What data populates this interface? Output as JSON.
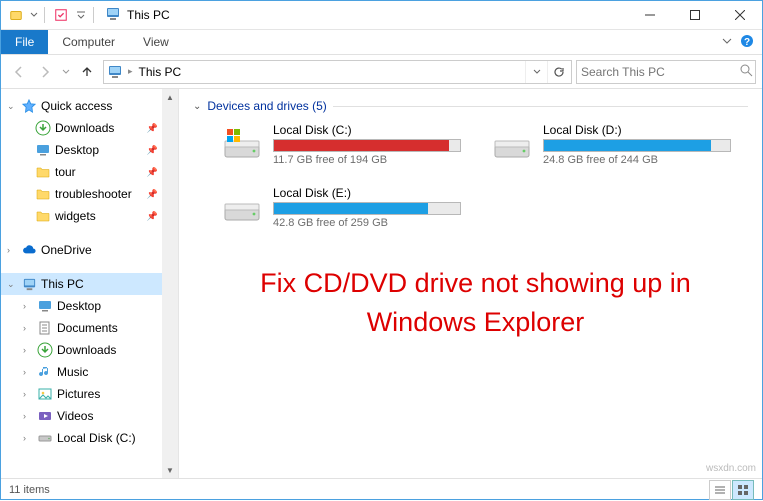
{
  "window": {
    "title": "This PC"
  },
  "ribbon": {
    "file": "File",
    "tabs": [
      "Computer",
      "View"
    ]
  },
  "nav": {
    "location": "This PC",
    "search_placeholder": "Search This PC"
  },
  "sidebar": {
    "quick_access": {
      "label": "Quick access"
    },
    "quick_items": [
      {
        "label": "Downloads",
        "icon": "downloads"
      },
      {
        "label": "Desktop",
        "icon": "desktop"
      },
      {
        "label": "tour",
        "icon": "folder"
      },
      {
        "label": "troubleshooter",
        "icon": "folder"
      },
      {
        "label": "widgets",
        "icon": "folder"
      }
    ],
    "onedrive": {
      "label": "OneDrive"
    },
    "this_pc": {
      "label": "This PC"
    },
    "pc_items": [
      {
        "label": "Desktop",
        "icon": "desktop"
      },
      {
        "label": "Documents",
        "icon": "documents"
      },
      {
        "label": "Downloads",
        "icon": "downloads"
      },
      {
        "label": "Music",
        "icon": "music"
      },
      {
        "label": "Pictures",
        "icon": "pictures"
      },
      {
        "label": "Videos",
        "icon": "videos"
      },
      {
        "label": "Local Disk (C:)",
        "icon": "drive"
      }
    ]
  },
  "content": {
    "group_title": "Devices and drives (5)",
    "drives": [
      {
        "name": "Local Disk (C:)",
        "free": "11.7 GB free of 194 GB",
        "fill_pct": 94,
        "color": "#d62e2e"
      },
      {
        "name": "Local Disk (D:)",
        "free": "24.8 GB free of 244 GB",
        "fill_pct": 90,
        "color": "#1d9fe4"
      },
      {
        "name": "Local Disk (E:)",
        "free": "42.8 GB free of 259 GB",
        "fill_pct": 83,
        "color": "#1d9fe4"
      }
    ],
    "overlay": "Fix CD/DVD drive not showing up in Windows Explorer"
  },
  "status": {
    "count": "11 items"
  },
  "watermark": "wsxdn.com"
}
